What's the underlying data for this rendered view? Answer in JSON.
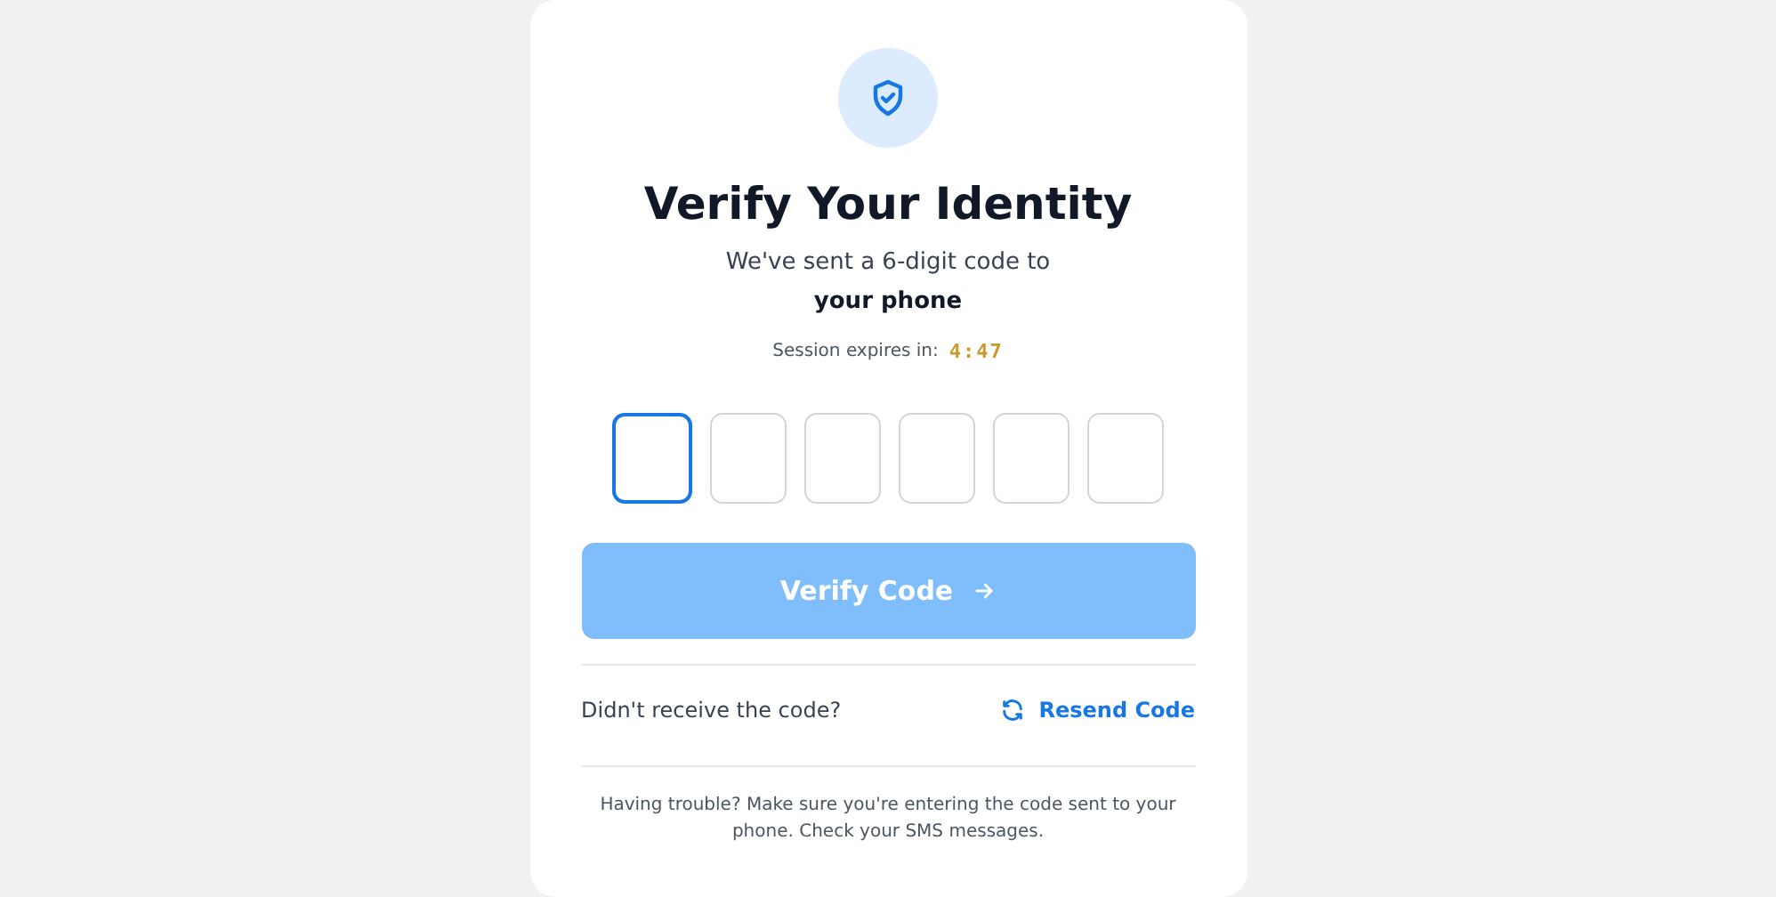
{
  "card": {
    "title": "Verify Your Identity",
    "subtitle": "We've sent a 6-digit code to",
    "destination": "your phone",
    "session": {
      "label": "Session expires in:",
      "time": "4:47"
    },
    "code_boxes": [
      {
        "focused": true
      },
      {
        "focused": false
      },
      {
        "focused": false
      },
      {
        "focused": false
      },
      {
        "focused": false
      },
      {
        "focused": false
      }
    ],
    "verify_button": {
      "label": "Verify Code",
      "disabled": true
    },
    "resend": {
      "prompt": "Didn't receive the code?",
      "link": "Resend Code"
    },
    "help": "Having trouble? Make sure you're entering the code sent to your phone. Check your SMS messages."
  }
}
